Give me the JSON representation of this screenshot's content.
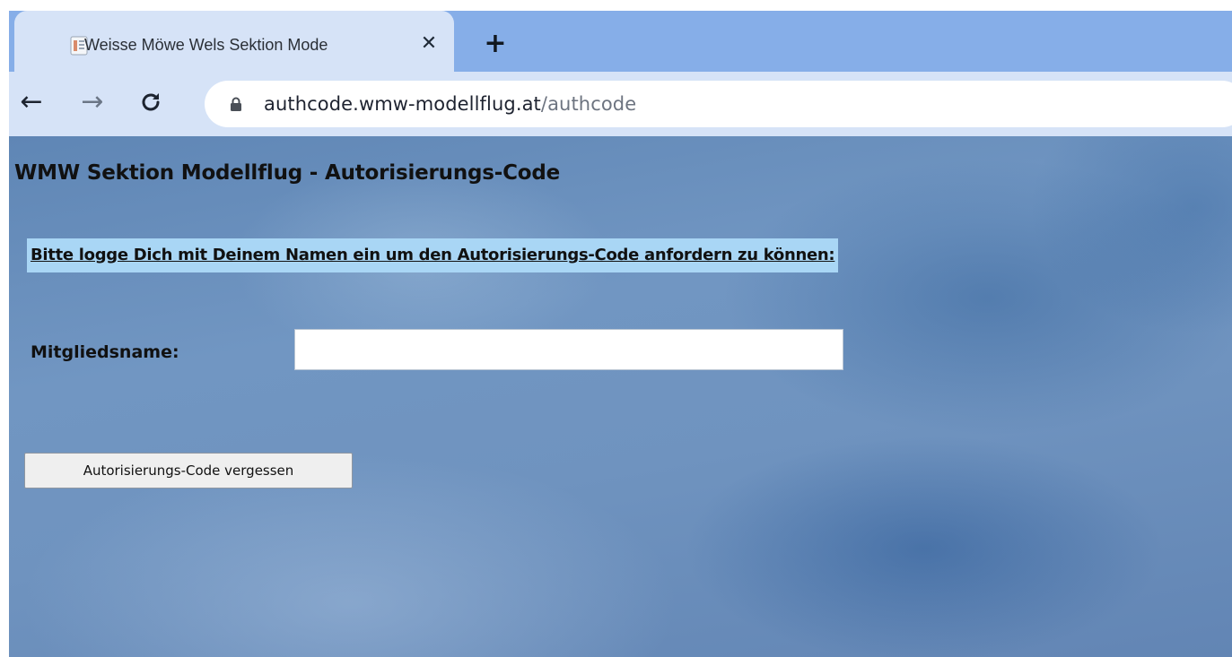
{
  "browser": {
    "tab": {
      "title": "Weisse Möwe Wels Sektion Mode",
      "close_icon": "close-icon",
      "favicon": "page-favicon-icon"
    },
    "new_tab_label": "+",
    "toolbar": {
      "back_icon": "arrow-left-icon",
      "forward_icon": "arrow-right-icon",
      "reload_icon": "reload-icon",
      "lock_icon": "lock-icon",
      "url_host": "authcode.wmw-modellflug.at",
      "url_path": "/authcode"
    }
  },
  "page": {
    "title": "WMW Sektion Modellflug - Autorisierungs-Code",
    "instruction": "Bitte logge Dich mit Deinem Namen ein um den Autorisierungs-Code anfordern zu können:",
    "member_label": "Mitgliedsname:",
    "member_input_value": "",
    "member_input_placeholder": "",
    "forgot_button_label": "Autorisierungs-Code vergessen"
  },
  "colors": {
    "tabstrip": "#86aee8",
    "toolbar": "#d6e3f7",
    "instruction_highlight": "#a9d6f5",
    "page_background": "#6f93bf"
  }
}
